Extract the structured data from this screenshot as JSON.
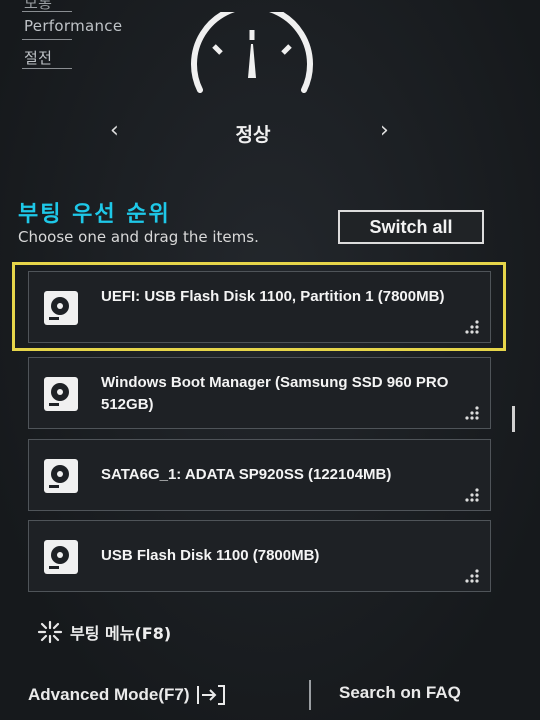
{
  "modes": {
    "items": [
      "보통",
      "Performance",
      "절전"
    ]
  },
  "profile": {
    "current": "정상",
    "prev_symbol": "‹",
    "next_symbol": "›"
  },
  "boot_priority": {
    "title": "부팅 우선 순위",
    "subtitle": "Choose one and drag the items.",
    "switch_all_label": "Switch all",
    "items": [
      {
        "label": "UEFI: USB Flash Disk 1100, Partition 1 (7800MB)",
        "icon": "disk-icon",
        "selected": true
      },
      {
        "label": "Windows Boot Manager (Samsung SSD 960 PRO 512GB)",
        "icon": "disk-icon",
        "selected": false
      },
      {
        "label": "SATA6G_1: ADATA SP920SS  (122104MB)",
        "icon": "disk-icon",
        "selected": false
      },
      {
        "label": "USB Flash Disk 1100  (7800MB)",
        "icon": "disk-icon",
        "selected": false
      }
    ]
  },
  "boot_menu": {
    "label": "부팅 메뉴(F8)",
    "icon": "sparkle-icon"
  },
  "footer": {
    "advanced_mode_label": "Advanced Mode(F7)",
    "advanced_icon": "exit-arrow-icon",
    "search_faq_label": "Search on FAQ"
  },
  "colors": {
    "accent": "#1ec8e8",
    "highlight": "#e6d54a",
    "background": "#1b1e22"
  }
}
